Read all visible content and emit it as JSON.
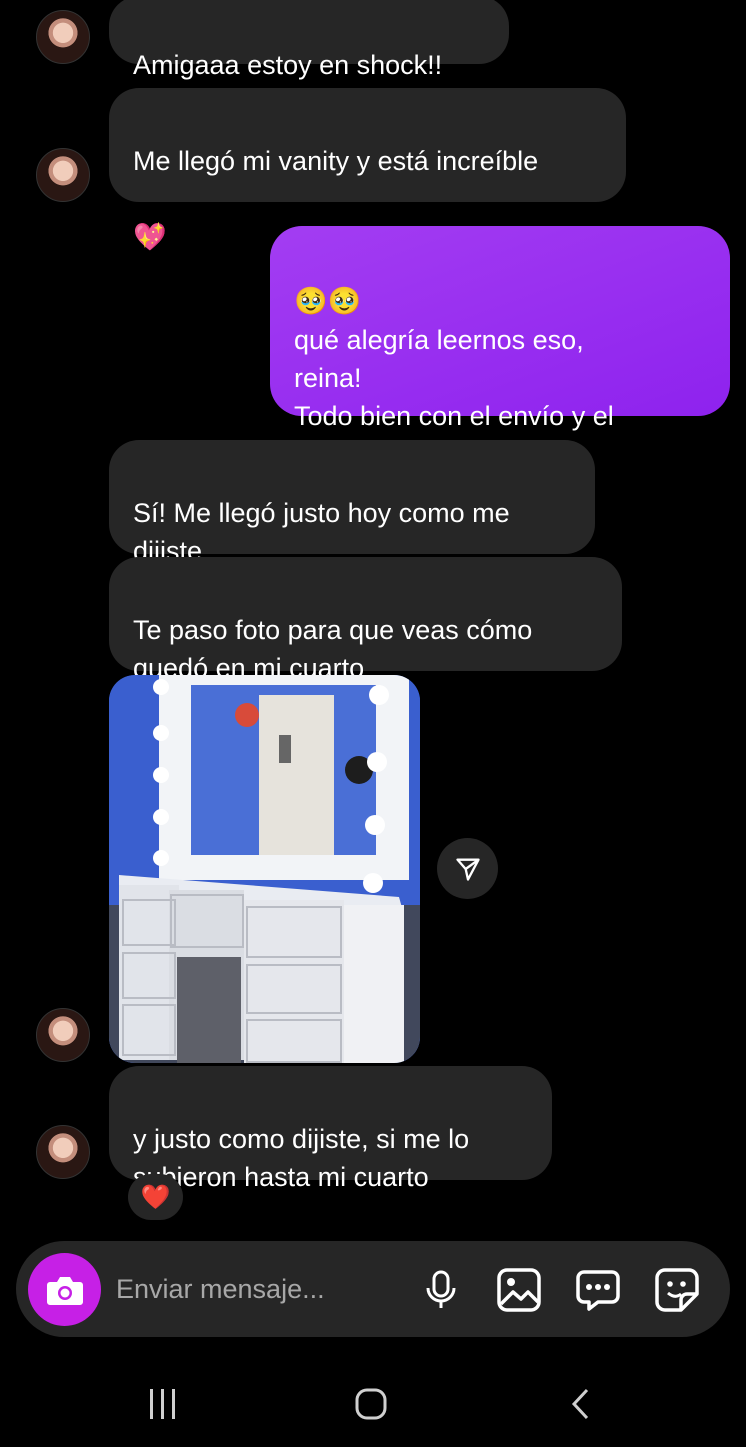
{
  "messages": [
    {
      "id": "m1",
      "direction": "incoming",
      "text": "Amigaaa estoy en shock!!"
    },
    {
      "id": "m2",
      "direction": "incoming",
      "text": "Me llegó mi vanity y está increíble",
      "emoji": "💖"
    },
    {
      "id": "m3",
      "direction": "outgoing",
      "emoji": "🥹🥹",
      "text": "qué alegría leernos eso,\nreina!\nTodo bien con el envío y el\narmado?"
    },
    {
      "id": "m4",
      "direction": "incoming",
      "text": "Sí! Me llegó justo hoy como me\ndijiste"
    },
    {
      "id": "m5",
      "direction": "incoming",
      "text": "Te paso foto para que veas cómo\nquedó en mi cuarto",
      "emoji": "😍"
    },
    {
      "id": "m6",
      "direction": "incoming",
      "type": "photo"
    },
    {
      "id": "m7",
      "direction": "incoming",
      "text": "y justo como dijiste, si me lo\nsubieron hasta mi cuarto",
      "reaction": "❤️"
    }
  ],
  "composer": {
    "placeholder": "Enviar mensaje...",
    "accent_color": "#c620e6",
    "icons": [
      "camera-icon",
      "microphone-icon",
      "gallery-icon",
      "chat-bubble-icon",
      "sticker-icon"
    ]
  },
  "colors": {
    "incoming_bubble": "#262626",
    "outgoing_bubble": "#9a2ff0",
    "background": "#000000"
  },
  "navbar": {
    "icons": [
      "recent-apps-icon",
      "home-icon",
      "back-icon"
    ]
  }
}
